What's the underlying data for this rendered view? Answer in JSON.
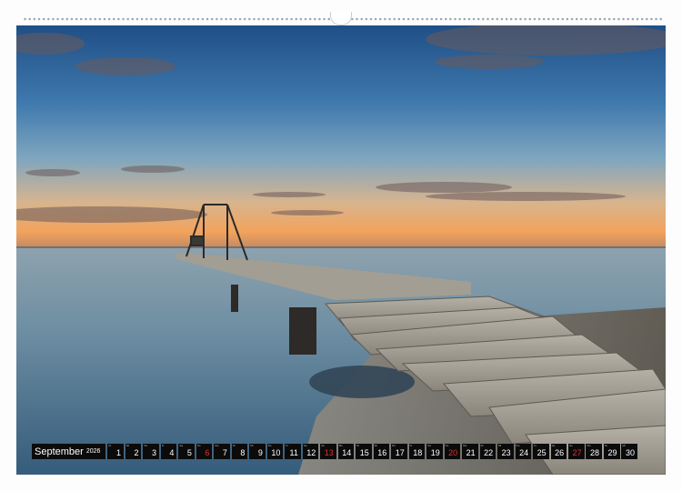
{
  "calendar": {
    "month": "September",
    "year": "2026",
    "days": [
      {
        "n": "1",
        "abbr": "Di",
        "sunday": false
      },
      {
        "n": "2",
        "abbr": "Mi",
        "sunday": false
      },
      {
        "n": "3",
        "abbr": "Do",
        "sunday": false
      },
      {
        "n": "4",
        "abbr": "Fr",
        "sunday": false
      },
      {
        "n": "5",
        "abbr": "Sa",
        "sunday": false
      },
      {
        "n": "6",
        "abbr": "So",
        "sunday": true
      },
      {
        "n": "7",
        "abbr": "Mo",
        "sunday": false
      },
      {
        "n": "8",
        "abbr": "Di",
        "sunday": false
      },
      {
        "n": "9",
        "abbr": "Mi",
        "sunday": false
      },
      {
        "n": "10",
        "abbr": "Do",
        "sunday": false
      },
      {
        "n": "11",
        "abbr": "Fr",
        "sunday": false
      },
      {
        "n": "12",
        "abbr": "Sa",
        "sunday": false
      },
      {
        "n": "13",
        "abbr": "So",
        "sunday": true
      },
      {
        "n": "14",
        "abbr": "Mo",
        "sunday": false
      },
      {
        "n": "15",
        "abbr": "Di",
        "sunday": false
      },
      {
        "n": "16",
        "abbr": "Mi",
        "sunday": false
      },
      {
        "n": "17",
        "abbr": "Do",
        "sunday": false
      },
      {
        "n": "18",
        "abbr": "Fr",
        "sunday": false
      },
      {
        "n": "19",
        "abbr": "Sa",
        "sunday": false
      },
      {
        "n": "20",
        "abbr": "So",
        "sunday": true
      },
      {
        "n": "21",
        "abbr": "Mo",
        "sunday": false
      },
      {
        "n": "22",
        "abbr": "Di",
        "sunday": false
      },
      {
        "n": "23",
        "abbr": "Mi",
        "sunday": false
      },
      {
        "n": "24",
        "abbr": "Do",
        "sunday": false
      },
      {
        "n": "25",
        "abbr": "Fr",
        "sunday": false
      },
      {
        "n": "26",
        "abbr": "Sa",
        "sunday": false
      },
      {
        "n": "27",
        "abbr": "So",
        "sunday": true
      },
      {
        "n": "28",
        "abbr": "Mo",
        "sunday": false
      },
      {
        "n": "29",
        "abbr": "Di",
        "sunday": false
      },
      {
        "n": "30",
        "abbr": "Mi",
        "sunday": false
      }
    ]
  },
  "colors": {
    "sunday": "#e53030",
    "day_cell": "#0b0b0b",
    "binding_holes": "#9aa3ad"
  },
  "photo": {
    "subject": "wooden-pier-at-dusk"
  }
}
